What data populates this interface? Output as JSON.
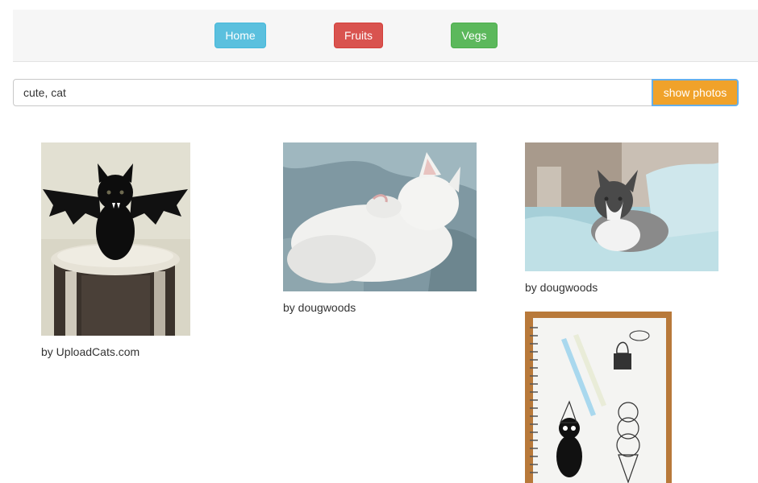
{
  "nav": {
    "home_label": "Home",
    "fruits_label": "Fruits",
    "vegs_label": "Vegs"
  },
  "search": {
    "value": "cute, cat",
    "button_label": "show photos"
  },
  "photos": [
    {
      "caption": "by UploadCats.com",
      "subject": "black kitten in bat costume on stool"
    },
    {
      "caption": "by dougwoods",
      "subject": "white cat licking paw"
    },
    {
      "caption": "by dougwoods",
      "subject": "black and white kitten on blanket"
    },
    {
      "caption": "",
      "subject": "sketchbook with cat drawing and pens"
    }
  ],
  "colors": {
    "home": "#5bc0de",
    "fruits": "#d9534f",
    "vegs": "#5cb85c",
    "search_button": "#f0a22a"
  }
}
